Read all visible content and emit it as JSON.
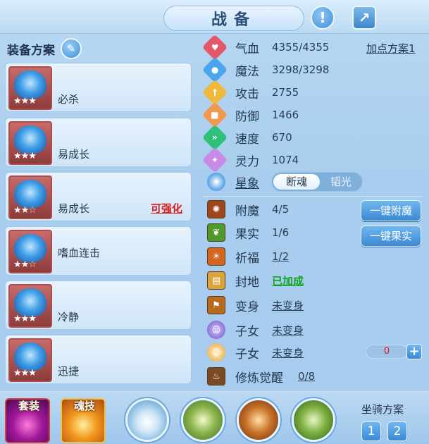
{
  "header": {
    "title": "战备"
  },
  "left": {
    "title": "装备方案",
    "cards": [
      {
        "name": "必杀",
        "stars_filled": 3,
        "tag": ""
      },
      {
        "name": "易成长",
        "stars_filled": 3,
        "tag": ""
      },
      {
        "name": "易成长",
        "stars_filled": 2,
        "tag": "可强化"
      },
      {
        "name": "嗜血连击",
        "stars_filled": 2,
        "tag": ""
      },
      {
        "name": "冷静",
        "stars_filled": 3,
        "tag": ""
      },
      {
        "name": "迅捷",
        "stars_filled": 3,
        "tag": ""
      }
    ]
  },
  "stats": {
    "plan_link": "加点方案1",
    "items": [
      {
        "label": "气血",
        "value": "4355/4355"
      },
      {
        "label": "魔法",
        "value": "3298/3298"
      },
      {
        "label": "攻击",
        "value": "2755"
      },
      {
        "label": "防御",
        "value": "1466"
      },
      {
        "label": "速度",
        "value": "670"
      },
      {
        "label": "灵力",
        "value": "1074"
      }
    ],
    "star_label": "星象",
    "toggle_on": "断魂",
    "toggle_off": "韬光"
  },
  "buffs": {
    "items": [
      {
        "label": "附魔",
        "value": "4/5"
      },
      {
        "label": "果实",
        "value": "1/6"
      },
      {
        "label": "祈福",
        "value": "1/2"
      },
      {
        "label": "封地",
        "value": "已加成"
      },
      {
        "label": "变身",
        "value": "未变身"
      },
      {
        "label": "子女",
        "value": "未变身"
      },
      {
        "label": "子女",
        "value": "未变身"
      },
      {
        "label": "修炼觉醒",
        "value": "0/8"
      }
    ],
    "btn_enchant": "一键附魔",
    "btn_fruit": "一键果实",
    "stepper_value": "0",
    "stepper_plus": "+"
  },
  "bottom": {
    "suit_label": "套装",
    "soul_label": "魂技",
    "mount_label": "坐骑方案",
    "mount_1": "1",
    "mount_2": "2"
  }
}
